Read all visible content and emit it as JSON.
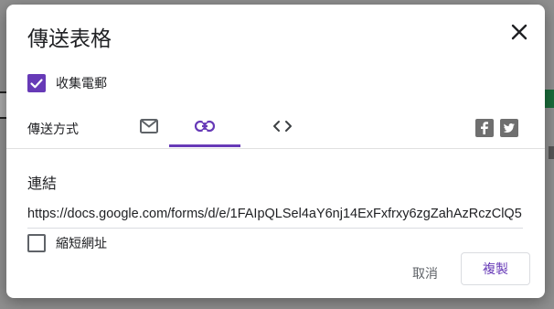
{
  "dialog": {
    "title": "傳送表格",
    "close_icon": "close-icon"
  },
  "collect_emails": {
    "label": "收集電郵",
    "checked": true
  },
  "send_via": {
    "label": "傳送方式",
    "tabs": [
      {
        "icon": "email-icon",
        "active": false
      },
      {
        "icon": "link-icon",
        "active": true
      },
      {
        "icon": "embed-code-icon",
        "active": false
      }
    ],
    "social": [
      {
        "icon": "facebook-icon"
      },
      {
        "icon": "twitter-icon"
      }
    ]
  },
  "link_section": {
    "title": "連結",
    "url": "https://docs.google.com/forms/d/e/1FAIpQLSel4aY6nj14ExFxfrxy6zgZahAzRczClQ5",
    "shorten_label": "縮短網址",
    "shorten_checked": false
  },
  "actions": {
    "cancel_label": "取消",
    "copy_label": "複製"
  },
  "colors": {
    "accent": "#673ab7",
    "text": "#202124",
    "muted": "#5f6368"
  }
}
